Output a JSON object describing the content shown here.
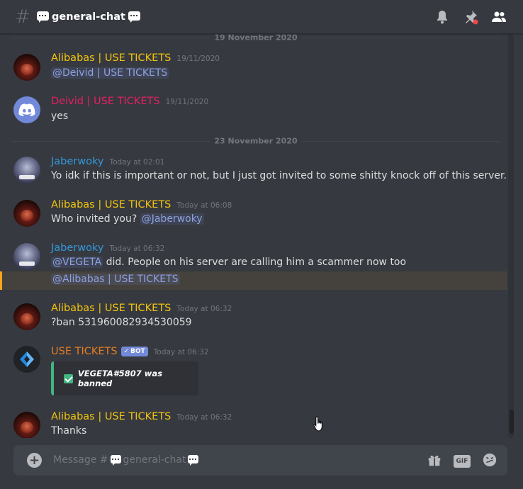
{
  "header": {
    "channel_name": "general-chat",
    "icons": [
      "hash-icon",
      "bell-icon",
      "pin-icon",
      "members-icon"
    ]
  },
  "dividers": [
    "19 November 2020",
    "23 November 2020"
  ],
  "messages": [
    {
      "author": "Alibabas | USE TICKETS",
      "author_color": "#f1c40f",
      "timestamp": "19/11/2020",
      "mention": "@Deivid | USE TICKETS",
      "text": ""
    },
    {
      "author": "Deivid | USE TICKETS",
      "author_color": "#e91e63",
      "timestamp": "19/11/2020",
      "text": "yes"
    },
    {
      "author": "Jaberwoky",
      "author_color": "#3498db",
      "timestamp": "Today at 02:01",
      "text": "Yo idk if this is important or not, but I just got invited to some shitty knock off of this server."
    },
    {
      "author": "Alibabas | USE TICKETS",
      "author_color": "#f1c40f",
      "timestamp": "Today at 06:08",
      "text": "Who invited you?",
      "mention": "@Jaberwoky"
    },
    {
      "author": "Jaberwoky",
      "author_color": "#3498db",
      "timestamp": "Today at 06:32",
      "mention": "@VEGETA",
      "text": "did. People on his server are calling him a scammer now too",
      "followup_mention": "@Alibabas | USE TICKETS"
    },
    {
      "author": "Alibabas | USE TICKETS",
      "author_color": "#f1c40f",
      "timestamp": "Today at 06:32",
      "text": "?ban 531960082934530059"
    },
    {
      "author": "USE TICKETS",
      "author_color": "#e67e22",
      "bot_tag": "BOT",
      "timestamp": "Today at 06:32",
      "embed_text": "VEGETA#5807 was banned"
    },
    {
      "author": "Alibabas | USE TICKETS",
      "author_color": "#f1c40f",
      "timestamp": "Today at 06:32",
      "text": "Thanks"
    }
  ],
  "composer": {
    "placeholder_prefix": "Message #",
    "placeholder_channel": "general-chat",
    "gif_label": "GIF",
    "icons": [
      "add-icon",
      "gift-icon",
      "gif-icon",
      "emoji-icon"
    ]
  },
  "colors": {
    "background": "#36393f",
    "mention": "#8ea1e1",
    "highlight_border": "#faa61a",
    "embed_border": "#43b581"
  }
}
